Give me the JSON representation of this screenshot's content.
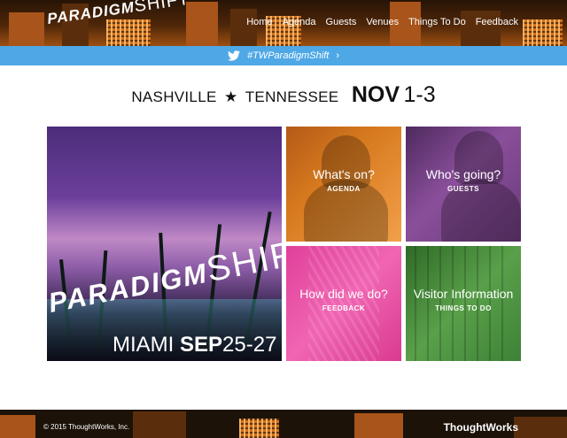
{
  "header": {
    "logo_bold": "PARADIGM",
    "logo_light": "SHIFT",
    "nav": [
      "Home",
      "Agenda",
      "Guests",
      "Venues",
      "Things To Do",
      "Feedback"
    ]
  },
  "twitter": {
    "icon": "twitter-bird-icon",
    "hashtag": "#TWParadigmShift",
    "chevron": "›"
  },
  "headline": {
    "city": "NASHVILLE",
    "star": "★",
    "state": "TENNESSEE",
    "month": "NOV",
    "dates": "1-3"
  },
  "hero": {
    "logo_bold": "PARADIGM",
    "logo_light": "SHIFT",
    "city": "MIAMI",
    "month": "SEP",
    "dates": "25-27"
  },
  "tiles": [
    {
      "title": "What's on?",
      "subtitle": "AGENDA",
      "color": "#d77a1f"
    },
    {
      "title": "Who's going?",
      "subtitle": "GUESTS",
      "color": "#8a4f9a"
    },
    {
      "title": "How did we do?",
      "subtitle": "FEEDBACK",
      "color": "#f065b2"
    },
    {
      "title": "Visitor Information",
      "subtitle": "THINGS TO DO",
      "color": "#59a04a"
    }
  ],
  "footer": {
    "copyright": "© 2015 ThoughtWorks, Inc.",
    "brand": "ThoughtWorks"
  }
}
